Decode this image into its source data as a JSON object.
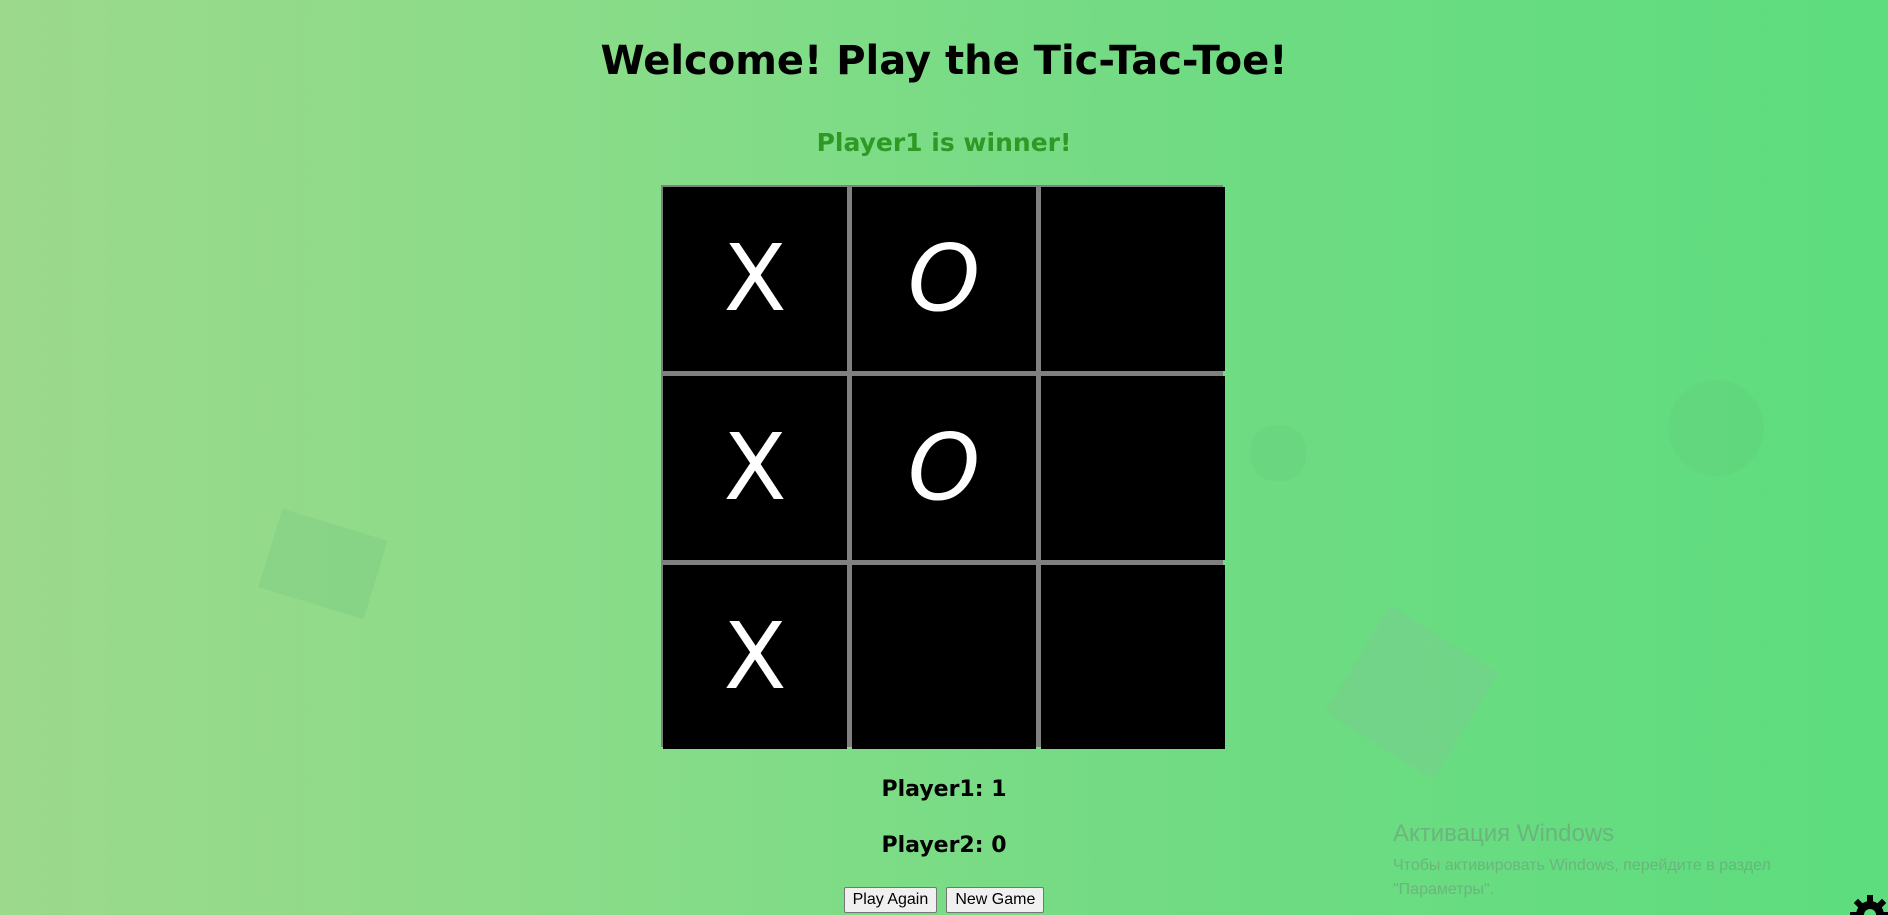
{
  "header": {
    "title": "Welcome! Play the Tic-Tac-Toe!",
    "status": "Player1 is winner!"
  },
  "board": {
    "cells": [
      "X",
      "O",
      "",
      "X",
      "O",
      "",
      "X",
      "",
      ""
    ]
  },
  "scores": {
    "player1": "Player1: 1",
    "player2": "Player2: 0"
  },
  "buttons": {
    "play_again": "Play Again",
    "new_game": "New Game"
  },
  "watermark": {
    "title": "Активация Windows",
    "line1": "Чтобы активировать Windows, перейдите в раздел",
    "line2": "\"Параметры\"."
  },
  "colors": {
    "status": "#2e9a25",
    "cell_bg": "#000000",
    "grid": "#808080"
  }
}
